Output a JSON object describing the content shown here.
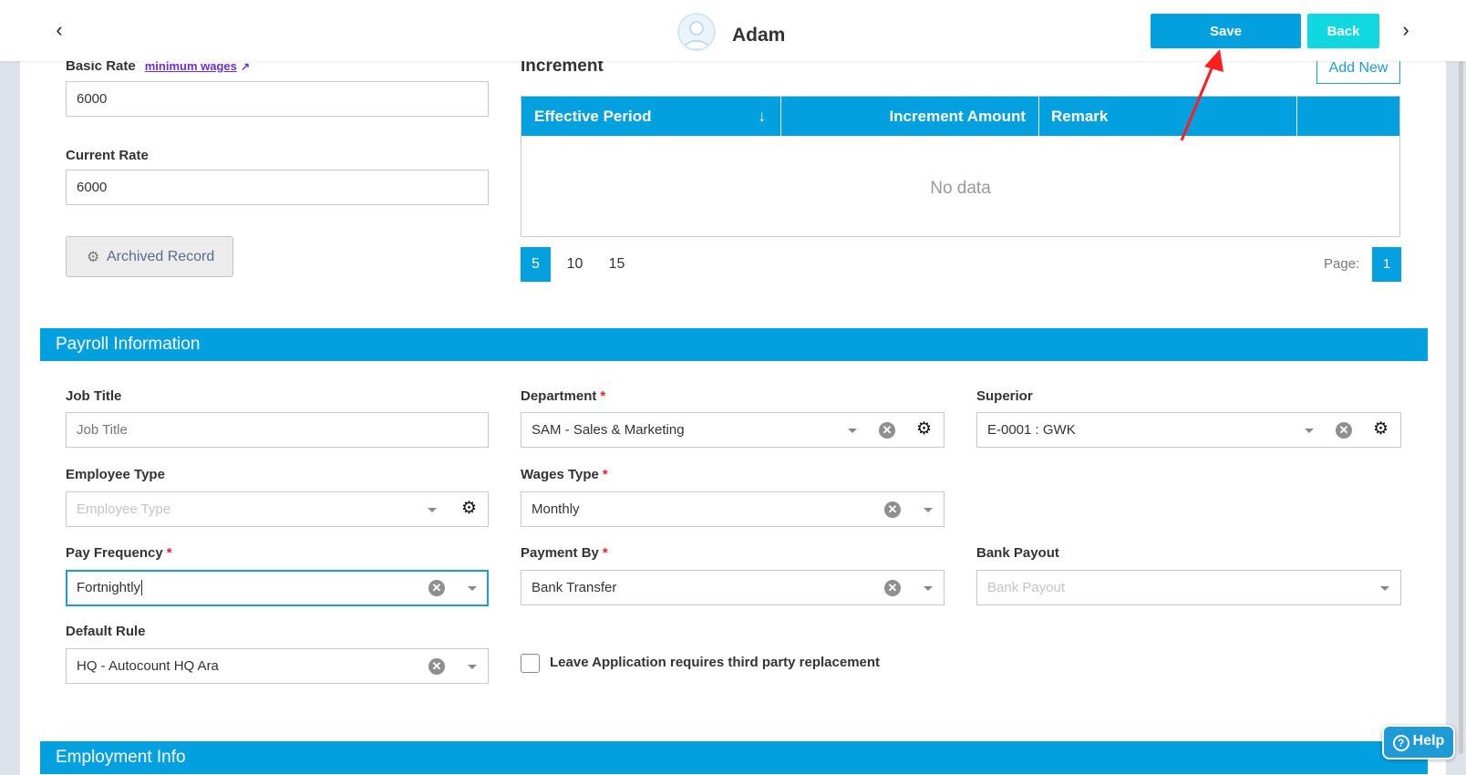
{
  "header": {
    "username": "Adam",
    "save_label": "Save",
    "back_label": "Back"
  },
  "rates": {
    "basic_rate_label": "Basic Rate",
    "minimum_wages_link": "minimum wages",
    "basic_rate_value": "6000",
    "current_rate_label": "Current Rate",
    "current_rate_value": "6000",
    "archived_record_label": "Archived Record"
  },
  "increment": {
    "title": "Increment",
    "add_new_label": "Add New",
    "columns": [
      "Effective Period",
      "Increment Amount",
      "Remark",
      ""
    ],
    "empty_text": "No data",
    "page_sizes": [
      "5",
      "10",
      "15"
    ],
    "selected_page_size": "5",
    "page_label": "Page:",
    "current_page": "1"
  },
  "payroll": {
    "section_title": "Payroll Information",
    "job_title": {
      "label": "Job Title",
      "placeholder": "Job Title",
      "value": ""
    },
    "department": {
      "label": "Department",
      "value": "SAM - Sales & Marketing",
      "required": "*"
    },
    "superior": {
      "label": "Superior",
      "value": "E-0001 : GWK"
    },
    "employee_type": {
      "label": "Employee Type",
      "placeholder": "Employee Type"
    },
    "wages_type": {
      "label": "Wages Type",
      "value": "Monthly",
      "required": "*"
    },
    "pay_frequency": {
      "label": "Pay Frequency",
      "value": "Fortnightly",
      "required": "*"
    },
    "payment_by": {
      "label": "Payment By",
      "value": "Bank Transfer",
      "required": "*"
    },
    "bank_payout": {
      "label": "Bank Payout",
      "placeholder": "Bank Payout"
    },
    "default_rule": {
      "label": "Default Rule",
      "value": "HQ - Autocount HQ Ara"
    },
    "leave_checkbox_label": "Leave Application requires third party replacement",
    "leave_checkbox_checked": false
  },
  "employment": {
    "section_title": "Employment Info"
  },
  "help_label": "Help",
  "colors": {
    "primary": "#03a0e0",
    "back_button": "#10d8e0",
    "required": "#e22222",
    "annotation_arrow": "#ff1e1e"
  },
  "icons": {
    "prev": "chevron-left-icon",
    "next": "chevron-right-icon",
    "avatar": "user-avatar-icon",
    "external": "external-link-icon",
    "archive": "archive-coins-icon",
    "sort": "sort-down-icon",
    "clear": "clear-circle-icon",
    "dropdown": "caret-down-icon",
    "settings": "gear-icon",
    "help": "question-circle-icon"
  }
}
